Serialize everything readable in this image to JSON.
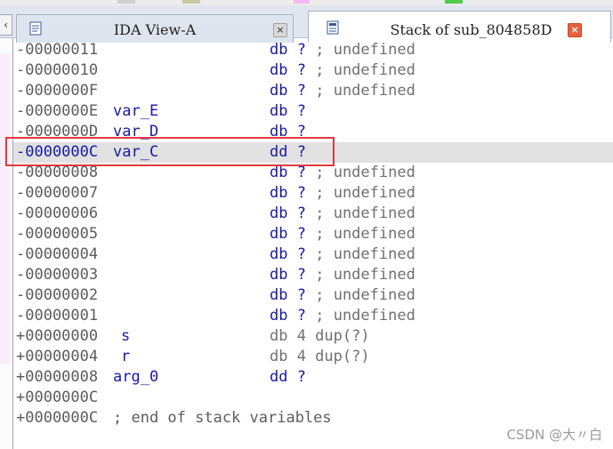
{
  "tabs": [
    {
      "label": "IDA View-A",
      "active": false,
      "icon": "disassembly-doc-icon",
      "close": "×"
    },
    {
      "label": "Stack of sub_804858D",
      "active": true,
      "icon": "stack-doc-icon",
      "close": "×"
    }
  ],
  "side_button": "‹",
  "rows": [
    {
      "addr": "-00000011",
      "name": "",
      "op": "db",
      "arg": "?",
      "comment": "; undefined"
    },
    {
      "addr": "-00000010",
      "name": "",
      "op": "db",
      "arg": "?",
      "comment": "; undefined"
    },
    {
      "addr": "-0000000F",
      "name": "",
      "op": "db",
      "arg": "?",
      "comment": "; undefined"
    },
    {
      "addr": "-0000000E",
      "name": "var_E",
      "op": "db",
      "arg": "?",
      "comment": ""
    },
    {
      "addr": "-0000000D",
      "name": "var_D",
      "op": "db",
      "arg": "?",
      "comment": ""
    },
    {
      "addr": "-0000000C",
      "name": "var_C",
      "op": "dd",
      "arg": "?",
      "comment": "",
      "selected": true
    },
    {
      "addr": "-00000008",
      "name": "",
      "op": "db",
      "arg": "?",
      "comment": "; undefined"
    },
    {
      "addr": "-00000007",
      "name": "",
      "op": "db",
      "arg": "?",
      "comment": "; undefined"
    },
    {
      "addr": "-00000006",
      "name": "",
      "op": "db",
      "arg": "?",
      "comment": "; undefined"
    },
    {
      "addr": "-00000005",
      "name": "",
      "op": "db",
      "arg": "?",
      "comment": "; undefined"
    },
    {
      "addr": "-00000004",
      "name": "",
      "op": "db",
      "arg": "?",
      "comment": "; undefined"
    },
    {
      "addr": "-00000003",
      "name": "",
      "op": "db",
      "arg": "?",
      "comment": "; undefined"
    },
    {
      "addr": "-00000002",
      "name": "",
      "op": "db",
      "arg": "?",
      "comment": "; undefined"
    },
    {
      "addr": "-00000001",
      "name": "",
      "op": "db",
      "arg": "?",
      "comment": "; undefined"
    },
    {
      "addr": "+00000000",
      "name": "s",
      "op": "db 4 dup(?)",
      "arg": "",
      "comment": "",
      "shifted": true,
      "plain": true
    },
    {
      "addr": "+00000004",
      "name": "r",
      "op": "db 4 dup(?)",
      "arg": "",
      "comment": "",
      "shifted": true,
      "plain": true
    },
    {
      "addr": "+00000008",
      "name": "arg_0",
      "op": "dd",
      "arg": "?",
      "comment": ""
    },
    {
      "addr": "+0000000C",
      "name": "",
      "op": "",
      "arg": "",
      "comment": ""
    },
    {
      "addr": "+0000000C",
      "name": "; end of stack variables",
      "op": "",
      "arg": "",
      "comment": "",
      "plainname": true
    }
  ],
  "watermark": "CSDN @大〃白",
  "colors": {
    "highlight_border": "#e0383e",
    "selected_row": "#e1e1e1",
    "close_active": "#e8603c",
    "keyword_blue": "#1a1a9a"
  }
}
